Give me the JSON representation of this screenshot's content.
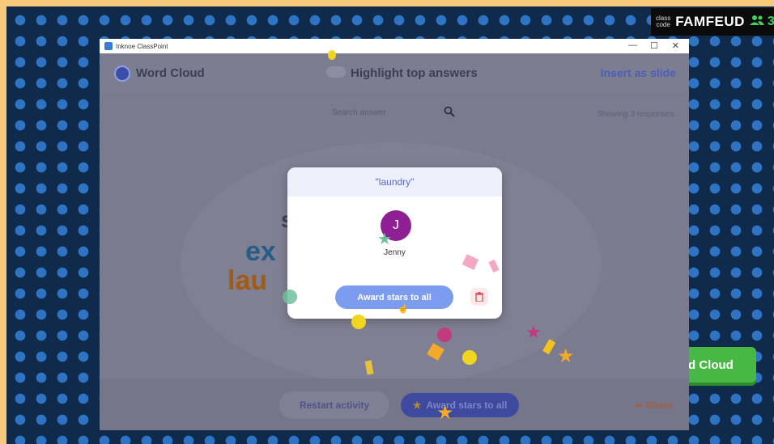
{
  "classcode": {
    "label_line1": "class",
    "label_line2": "code",
    "code": "FAMFEUD",
    "users": "3"
  },
  "green_button": {
    "label": "d Cloud"
  },
  "window": {
    "title": "Inknoe ClassPoint",
    "controls": {
      "minimize": "—",
      "maximize": "☐",
      "close": "✕"
    }
  },
  "header": {
    "title": "Word Cloud",
    "highlight": "Highlight top answers",
    "insert": "Insert as slide"
  },
  "content": {
    "search_placeholder": "Search answer",
    "showing": "Showing 3 responses",
    "words": [
      {
        "text": "s",
        "color": "#3f4453"
      },
      {
        "text": "ex",
        "color": "#255d86"
      },
      {
        "text": "lau",
        "color": "#a35a12"
      }
    ]
  },
  "footer": {
    "restart": "Restart activity",
    "award": "Award stars to all",
    "share": "Share"
  },
  "modal": {
    "title": "\"laundry\"",
    "avatar_initial": "J",
    "name": "Jenny",
    "award": "Award stars to all",
    "colors": {
      "avatar": "#8e1f94",
      "award_button": "#7c9cf0"
    }
  }
}
